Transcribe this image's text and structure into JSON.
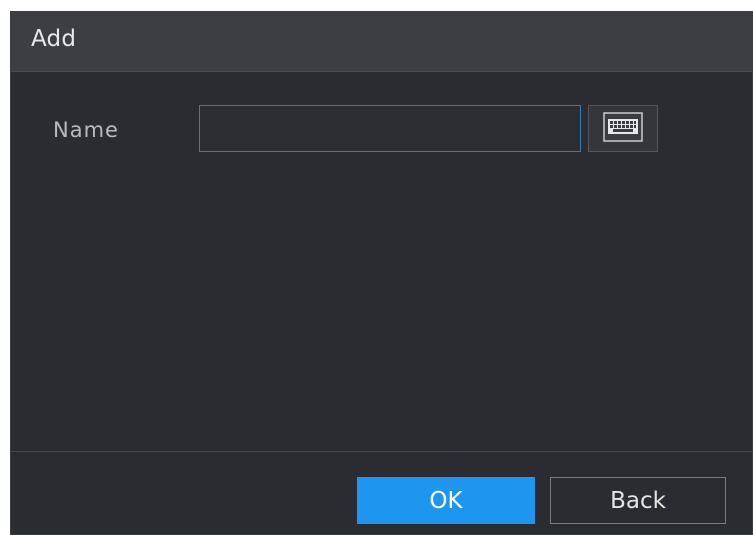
{
  "dialog": {
    "title": "Add"
  },
  "form": {
    "name_label": "Name",
    "name_value": "",
    "keyboard_icon": "keyboard-icon"
  },
  "footer": {
    "ok_label": "OK",
    "back_label": "Back"
  },
  "colors": {
    "dialog_bg": "#2a2c31",
    "titlebar_bg": "#3d3e43",
    "input_border": "#2f7fb4",
    "ok_bg": "#1e96f0"
  }
}
